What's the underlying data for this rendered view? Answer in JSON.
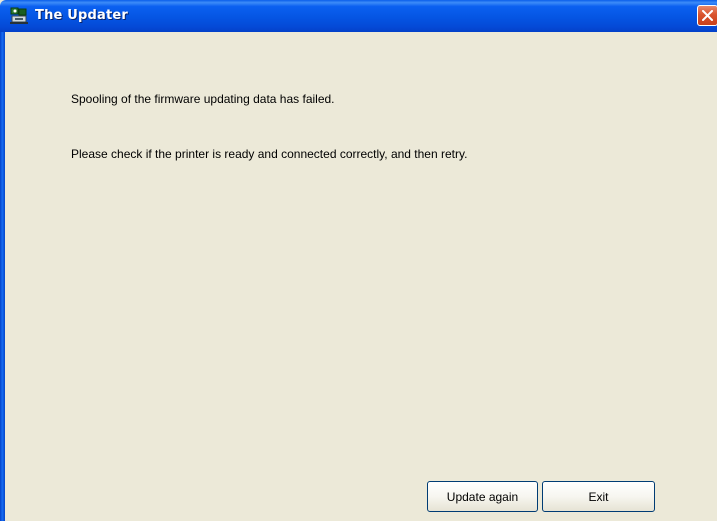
{
  "window": {
    "title": "The Updater",
    "app_icon": "printer-updater-icon",
    "close_icon": "close-icon"
  },
  "messages": {
    "line1": "Spooling of the firmware updating data has failed.",
    "line2": "Please check if the printer is ready and connected correctly, and then retry."
  },
  "buttons": {
    "update_again_label": "Update again",
    "exit_label": "Exit"
  },
  "colors": {
    "titlebar_blue": "#0555E3",
    "window_background": "#ECE9D8",
    "close_button_red": "#D9532D"
  }
}
